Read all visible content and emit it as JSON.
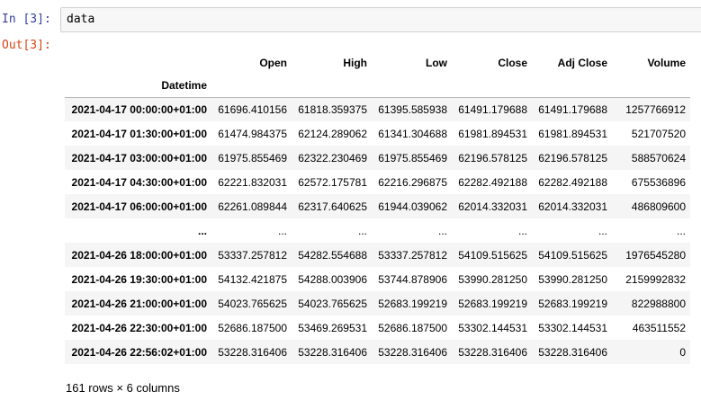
{
  "cell": {
    "in_prompt": "In [3]:",
    "code": "data",
    "out_prompt": "Out[3]:"
  },
  "dataframe": {
    "index_name": "Datetime",
    "columns": [
      "Open",
      "High",
      "Low",
      "Close",
      "Adj Close",
      "Volume"
    ],
    "rows": [
      {
        "index": "2021-04-17 00:00:00+01:00",
        "values": [
          "61696.410156",
          "61818.359375",
          "61395.585938",
          "61491.179688",
          "61491.179688",
          "1257766912"
        ]
      },
      {
        "index": "2021-04-17 01:30:00+01:00",
        "values": [
          "61474.984375",
          "62124.289062",
          "61341.304688",
          "61981.894531",
          "61981.894531",
          "521707520"
        ]
      },
      {
        "index": "2021-04-17 03:00:00+01:00",
        "values": [
          "61975.855469",
          "62322.230469",
          "61975.855469",
          "62196.578125",
          "62196.578125",
          "588570624"
        ]
      },
      {
        "index": "2021-04-17 04:30:00+01:00",
        "values": [
          "62221.832031",
          "62572.175781",
          "62216.296875",
          "62282.492188",
          "62282.492188",
          "675536896"
        ]
      },
      {
        "index": "2021-04-17 06:00:00+01:00",
        "values": [
          "62261.089844",
          "62317.640625",
          "61944.039062",
          "62014.332031",
          "62014.332031",
          "486809600"
        ]
      },
      {
        "index": "...",
        "values": [
          "...",
          "...",
          "...",
          "...",
          "...",
          "..."
        ]
      },
      {
        "index": "2021-04-26 18:00:00+01:00",
        "values": [
          "53337.257812",
          "54282.554688",
          "53337.257812",
          "54109.515625",
          "54109.515625",
          "1976545280"
        ]
      },
      {
        "index": "2021-04-26 19:30:00+01:00",
        "values": [
          "54132.421875",
          "54288.003906",
          "53744.878906",
          "53990.281250",
          "53990.281250",
          "2159992832"
        ]
      },
      {
        "index": "2021-04-26 21:00:00+01:00",
        "values": [
          "54023.765625",
          "54023.765625",
          "52683.199219",
          "52683.199219",
          "52683.199219",
          "822988800"
        ]
      },
      {
        "index": "2021-04-26 22:30:00+01:00",
        "values": [
          "52686.187500",
          "53469.269531",
          "52686.187500",
          "53302.144531",
          "53302.144531",
          "463511552"
        ]
      },
      {
        "index": "2021-04-26 22:56:02+01:00",
        "values": [
          "53228.316406",
          "53228.316406",
          "53228.316406",
          "53228.316406",
          "53228.316406",
          "0"
        ]
      }
    ],
    "shape_text": "161 rows × 6 columns"
  }
}
